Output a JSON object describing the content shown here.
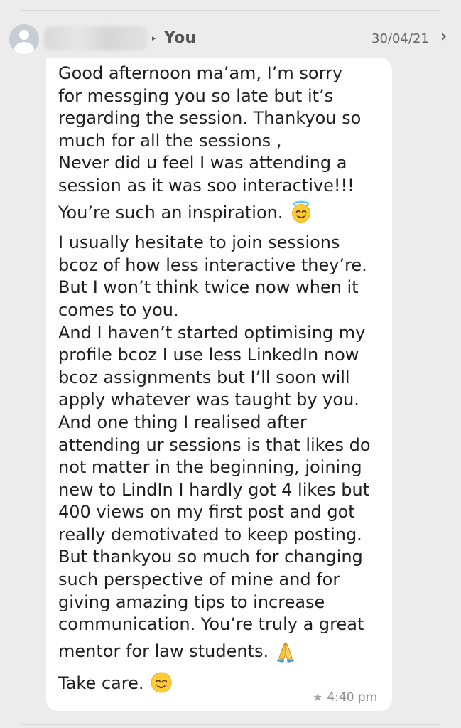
{
  "header": {
    "recipient": "You",
    "arrow": "▸",
    "date": "30/04/21",
    "chevron": "›"
  },
  "message": {
    "lines": [
      "Good afternoon ma’am, I’m sorry",
      "for messging you so late but it’s",
      "regarding the session. Thankyou so",
      "much for all the sessions ,",
      "Never did u feel I was attending a",
      "session as it was soo interactive!!!",
      "You’re such an inspiration.",
      "I usually hesitate to join sessions",
      "bcoz of how less interactive they’re.",
      "But I won’t think twice now when it",
      "comes to you.",
      "And I haven’t started optimising my",
      "profile bcoz I use less LinkedIn now",
      "bcoz assignments but I’ll soon will",
      "apply whatever was taught by you.",
      "And one thing I realised after",
      "attending ur sessions is that likes do",
      "not matter in the beginning, joining",
      "new to LindIn I hardly got 4 likes but",
      "400 views on my first post and got",
      "really demotivated to keep posting.",
      "But thankyou so much for changing",
      "such perspective of mine and for",
      "giving amazing tips to increase",
      "communication. You’re truly a great",
      "mentor for law students.",
      "Take care."
    ],
    "time": "4:40 pm",
    "star": "★"
  },
  "icons": {
    "avatar": "person-avatar-icon",
    "smiling_face_with_halo": "smiling-face-with-halo-emoji",
    "folded_hands": "folded-hands-emoji",
    "smiling_face": "smiling-face-emoji",
    "star": "star-icon",
    "chevron": "chevron-right-icon"
  },
  "colors": {
    "background": "#ececec",
    "bubble": "#ffffff",
    "text": "#1f1f1f",
    "time": "#8d8d8d",
    "avatar": "#c8cdd3"
  }
}
